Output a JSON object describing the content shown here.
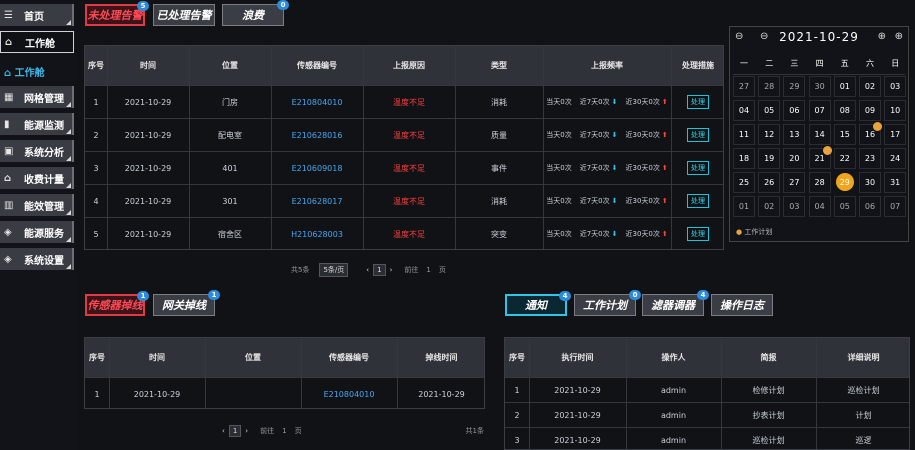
{
  "sidebar": {
    "home": "首页",
    "workbench": "工作舱",
    "workbench_sub": "工作舱",
    "items": [
      "网格管理",
      "能源监测",
      "系统分析",
      "收费计量",
      "能效管理",
      "能源服务",
      "系统设置"
    ]
  },
  "top_tabs": [
    {
      "label": "未处理告警",
      "badge": "5"
    },
    {
      "label": "已处理告警",
      "badge": ""
    },
    {
      "label": "浪费",
      "badge": "0"
    }
  ],
  "alarm": {
    "headers": [
      "序号",
      "时间",
      "位置",
      "传感器编号",
      "上报原因",
      "类型",
      "上报频率",
      "处理措施"
    ],
    "rows": [
      {
        "no": "1",
        "time": "2021-10-29",
        "loc": "门房",
        "id": "E210804010",
        "reason": "温度不足",
        "type": "消耗",
        "today": "当天0次",
        "d7": "近7天0次",
        "d30": "近30天0次",
        "action": "处理"
      },
      {
        "no": "2",
        "time": "2021-10-29",
        "loc": "配电室",
        "id": "E210628016",
        "reason": "温度不足",
        "type": "质量",
        "today": "当天0次",
        "d7": "近7天0次",
        "d30": "近30天0次",
        "action": "处理"
      },
      {
        "no": "3",
        "time": "2021-10-29",
        "loc": "401",
        "id": "E210609018",
        "reason": "温度不足",
        "type": "事件",
        "today": "当天0次",
        "d7": "近7天0次",
        "d30": "近30天0次",
        "action": "处理"
      },
      {
        "no": "4",
        "time": "2021-10-29",
        "loc": "301",
        "id": "E210628017",
        "reason": "温度不足",
        "type": "消耗",
        "today": "当天0次",
        "d7": "近7天0次",
        "d30": "近30天0次",
        "action": "处理"
      },
      {
        "no": "5",
        "time": "2021-10-29",
        "loc": "宿舍区",
        "id": "H210628003",
        "reason": "温度不足",
        "type": "突变",
        "today": "当天0次",
        "d7": "近7天0次",
        "d30": "近30天0次",
        "action": "处理"
      }
    ],
    "pager": {
      "total": "共5条",
      "size": "5条/页",
      "page": "1",
      "goto": "前往",
      "goto_page": "1",
      "unit": "页"
    }
  },
  "sensor_tabs": [
    {
      "label": "传感器掉线",
      "badge": "1"
    },
    {
      "label": "网关掉线",
      "badge": "1"
    }
  ],
  "sensor": {
    "headers": [
      "序号",
      "时间",
      "位置",
      "传感器编号",
      "掉线时间"
    ],
    "rows": [
      {
        "no": "1",
        "time": "2021-10-29",
        "loc": "",
        "id": "E210804010",
        "off": "2021-10-29"
      }
    ],
    "pager": {
      "page": "1",
      "goto": "前往",
      "goto_page": "1",
      "unit": "页",
      "total": "共1条"
    }
  },
  "notice_tabs": [
    {
      "label": "通知",
      "badge": "4"
    },
    {
      "label": "工作计划",
      "badge": "0"
    },
    {
      "label": "滤器调器",
      "badge": "4"
    },
    {
      "label": "操作日志",
      "badge": ""
    }
  ],
  "notice": {
    "headers": [
      "序号",
      "执行时间",
      "操作人",
      "简报",
      "详细说明"
    ],
    "rows": [
      {
        "no": "1",
        "time": "2021-10-29",
        "op": "admin",
        "brief": "检修计划",
        "detail": "巡检计划"
      },
      {
        "no": "2",
        "time": "2021-10-29",
        "op": "admin",
        "brief": "抄表计划",
        "detail": "计划"
      },
      {
        "no": "3",
        "time": "2021-10-29",
        "op": "admin",
        "brief": "巡检计划",
        "detail": "巡逻"
      }
    ]
  },
  "calendar": {
    "title": "2021-10-29",
    "weekdays": [
      "一",
      "二",
      "三",
      "四",
      "五",
      "六",
      "日"
    ],
    "days": [
      "27",
      "28",
      "29",
      "30",
      "01",
      "02",
      "03",
      "04",
      "05",
      "06",
      "07",
      "08",
      "09",
      "10",
      "11",
      "12",
      "13",
      "14",
      "15",
      "16",
      "17",
      "18",
      "19",
      "20",
      "21",
      "22",
      "23",
      "24",
      "25",
      "26",
      "27",
      "28",
      "29",
      "30",
      "31",
      "01",
      "02",
      "03",
      "04",
      "05",
      "06",
      "07"
    ],
    "legend": "工作计划"
  }
}
